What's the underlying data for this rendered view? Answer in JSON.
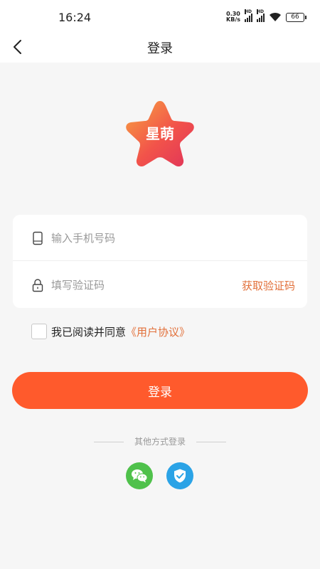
{
  "status_bar": {
    "time": "16:24",
    "net_speed_value": "0.30",
    "net_speed_unit": "KB/s",
    "hd_label": "HD",
    "battery": "66"
  },
  "nav": {
    "title": "登录"
  },
  "logo": {
    "text": "星萌"
  },
  "form": {
    "phone_placeholder": "输入手机号码",
    "phone_value": "",
    "code_placeholder": "填写验证码",
    "code_value": "",
    "get_code_label": "获取验证码"
  },
  "agreement": {
    "checked": false,
    "text": "我已阅读并同意",
    "link": "《用户协议》"
  },
  "login_button": {
    "label": "登录"
  },
  "other_login": {
    "label": "其他方式登录",
    "options": [
      {
        "icon": "wechat-icon",
        "color": "#4fc14b"
      },
      {
        "icon": "shield-check-icon",
        "color": "#2ba3e6"
      }
    ]
  },
  "colors": {
    "accent": "#ff5a2c",
    "link": "#e2703a",
    "background": "#f6f6f6"
  }
}
